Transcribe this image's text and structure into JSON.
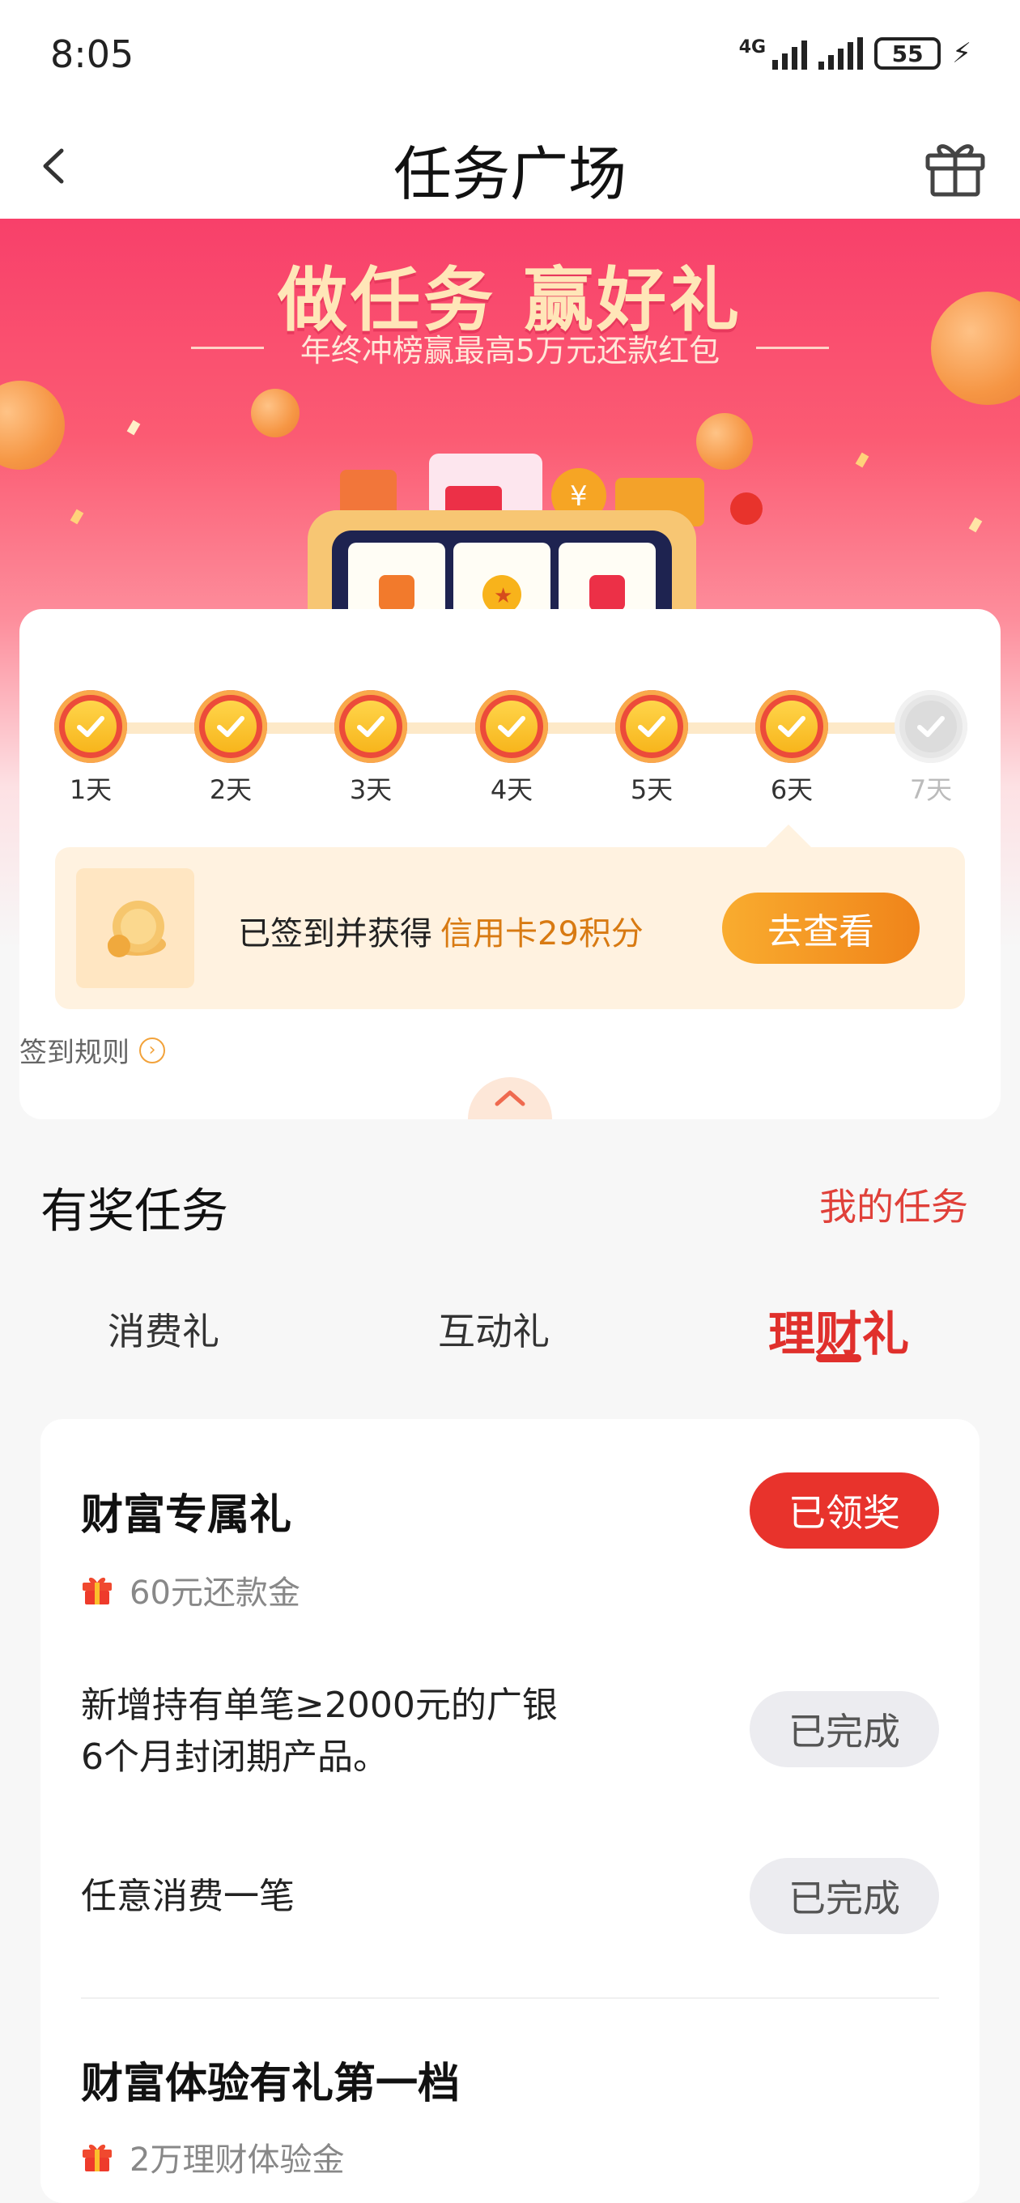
{
  "status_bar": {
    "time": "8:05",
    "network_primary": "4G",
    "battery": "55"
  },
  "nav": {
    "title": "任务广场"
  },
  "banner": {
    "title": "做任务 赢好礼",
    "subtitle": "年终冲榜赢最高5万元还款红包"
  },
  "checkin": {
    "days": [
      {
        "label": "1天",
        "checked": true
      },
      {
        "label": "2天",
        "checked": true
      },
      {
        "label": "3天",
        "checked": true
      },
      {
        "label": "4天",
        "checked": true
      },
      {
        "label": "5天",
        "checked": true
      },
      {
        "label": "6天",
        "checked": true
      },
      {
        "label": "7天",
        "checked": false
      }
    ],
    "reward_text": "已签到并获得",
    "reward_highlight": "信用卡29积分",
    "view_button": "去查看",
    "rules_link": "签到规则"
  },
  "tasks": {
    "header": "有奖任务",
    "my_tasks": "我的任务",
    "tabs": [
      {
        "label": "消费礼",
        "active": false
      },
      {
        "label": "互动礼",
        "active": false
      },
      {
        "label": "理财礼",
        "active": true
      }
    ],
    "groups": [
      {
        "title": "财富专属礼",
        "reward": "60元还款金",
        "status": "已领奖",
        "items": [
          {
            "text_line1": "新增持有单笔≥2000元的广银",
            "text_line2": "6个月封闭期产品。",
            "status": "已完成"
          },
          {
            "text_line1": "任意消费一笔",
            "text_line2": "",
            "status": "已完成"
          }
        ]
      },
      {
        "title": "财富体验有礼第一档",
        "reward": "2万理财体验金"
      }
    ]
  },
  "colors": {
    "accent_red": "#e0302c",
    "banner_pink": "#f8406a",
    "gold": "#f7b51c",
    "orange_btn": "#f0841a"
  }
}
